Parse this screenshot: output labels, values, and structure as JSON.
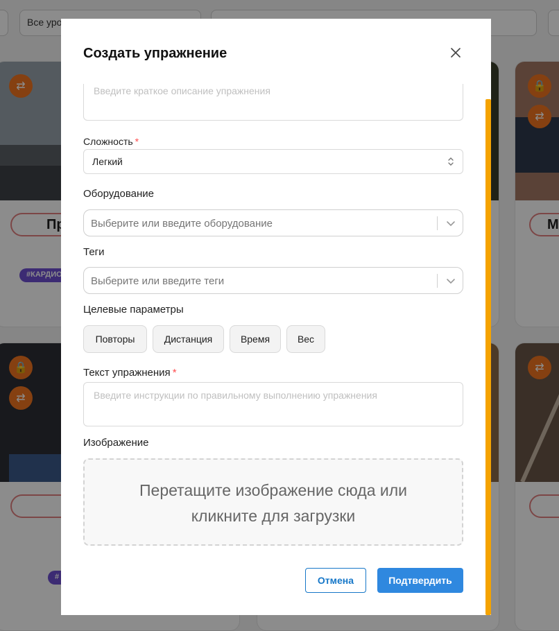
{
  "background": {
    "level_select_value": "Все уро",
    "card_title_left": "Пр",
    "card_title_right": "М",
    "card_tag": "#КАРДИО",
    "card_tag_short": "#"
  },
  "modal": {
    "title": "Создать упражнение",
    "description": {
      "placeholder": "Введите краткое описание упражнения"
    },
    "difficulty": {
      "label": "Сложность",
      "required_mark": "*",
      "value": "Легкий"
    },
    "equipment": {
      "label": "Оборудование",
      "placeholder": "Выберите или введите оборудование"
    },
    "tags": {
      "label": "Теги",
      "placeholder": "Выберите или введите теги"
    },
    "target_params": {
      "label": "Целевые параметры",
      "options": [
        "Повторы",
        "Дистанция",
        "Время",
        "Вес"
      ]
    },
    "exercise_text": {
      "label": "Текст упражнения",
      "required_mark": "*",
      "placeholder": "Введите инструкции по правильному выполнению упражнения"
    },
    "image": {
      "label": "Изображение",
      "dropzone_line1": "Перетащите изображение сюда или",
      "dropzone_line2": "кликните для загрузки"
    },
    "buttons": {
      "cancel": "Отмена",
      "confirm": "Подтвердить"
    }
  },
  "colors": {
    "primary": "#2f88df",
    "required": "#ff4d4f",
    "scrollbar": "#f5a300",
    "card_action": "#f2761f",
    "tag": "#6d4fd1"
  }
}
